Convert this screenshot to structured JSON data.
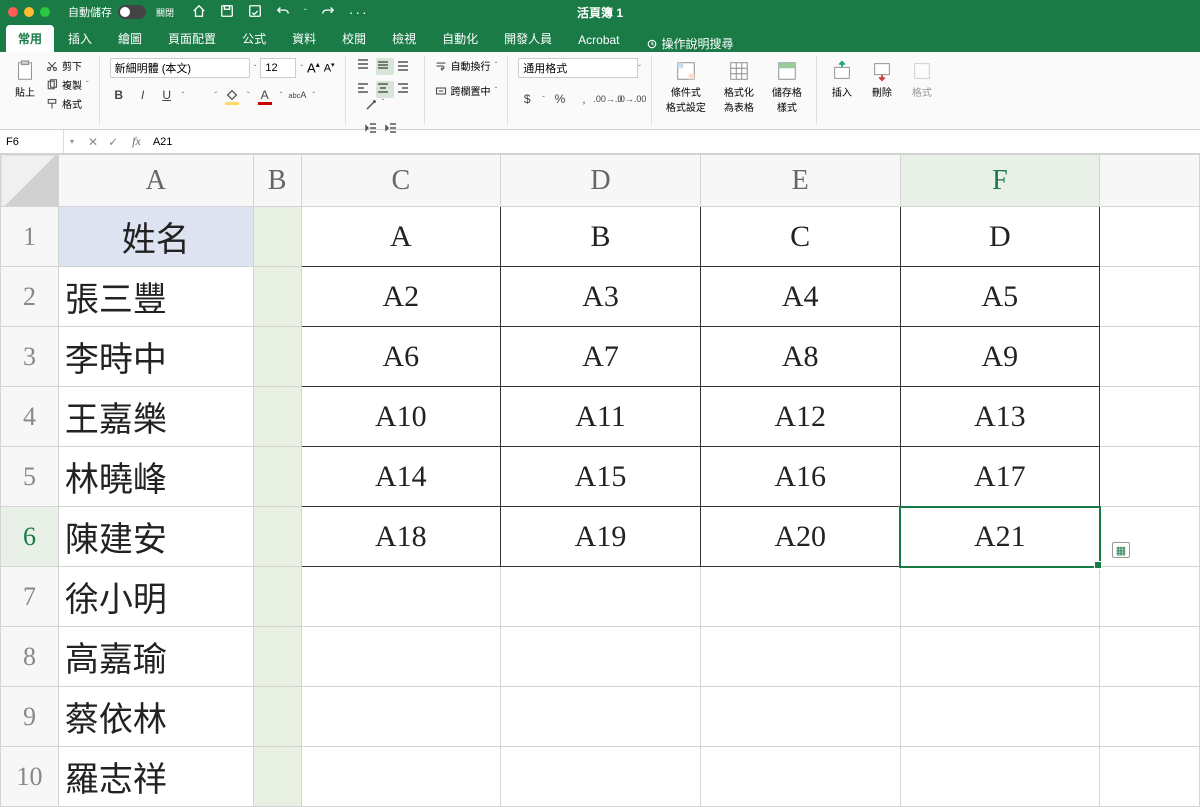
{
  "titlebar": {
    "autosave_label": "自動儲存",
    "autosave_state": "關閉",
    "workbook_title": "活頁簿 1"
  },
  "tabs": [
    "常用",
    "插入",
    "繪圖",
    "頁面配置",
    "公式",
    "資料",
    "校閱",
    "檢視",
    "自動化",
    "開發人員",
    "Acrobat"
  ],
  "tell_me": "操作說明搜尋",
  "ribbon": {
    "paste": "貼上",
    "cut": "剪下",
    "copy": "複製",
    "format_painter": "格式",
    "font_name": "新細明體 (本文)",
    "font_size": "12",
    "wrap": "自動換行",
    "merge": "跨欄置中",
    "number_format": "通用格式",
    "cond_fmt": "條件式\n格式設定",
    "fmt_table": "格式化\n為表格",
    "cell_styles": "儲存格\n樣式",
    "insert": "插入",
    "delete": "刪除",
    "format": "格式"
  },
  "namebox": "F6",
  "formula": "A21",
  "columns": [
    "A",
    "B",
    "C",
    "D",
    "E",
    "F"
  ],
  "rows": [
    {
      "n": "1",
      "a": "姓名",
      "c": "A",
      "d": "B",
      "e": "C",
      "f": "D"
    },
    {
      "n": "2",
      "a": "張三豐",
      "c": "A2",
      "d": "A3",
      "e": "A4",
      "f": "A5"
    },
    {
      "n": "3",
      "a": "李時中",
      "c": "A6",
      "d": "A7",
      "e": "A8",
      "f": "A9"
    },
    {
      "n": "4",
      "a": "王嘉樂",
      "c": "A10",
      "d": "A11",
      "e": "A12",
      "f": "A13"
    },
    {
      "n": "5",
      "a": "林曉峰",
      "c": "A14",
      "d": "A15",
      "e": "A16",
      "f": "A17"
    },
    {
      "n": "6",
      "a": "陳建安",
      "c": "A18",
      "d": "A19",
      "e": "A20",
      "f": "A21"
    },
    {
      "n": "7",
      "a": "徐小明",
      "c": "",
      "d": "",
      "e": "",
      "f": ""
    },
    {
      "n": "8",
      "a": "高嘉瑜",
      "c": "",
      "d": "",
      "e": "",
      "f": ""
    },
    {
      "n": "9",
      "a": "蔡依林",
      "c": "",
      "d": "",
      "e": "",
      "f": ""
    },
    {
      "n": "10",
      "a": "羅志祥",
      "c": "",
      "d": "",
      "e": "",
      "f": ""
    }
  ],
  "selected_cell": "F6"
}
